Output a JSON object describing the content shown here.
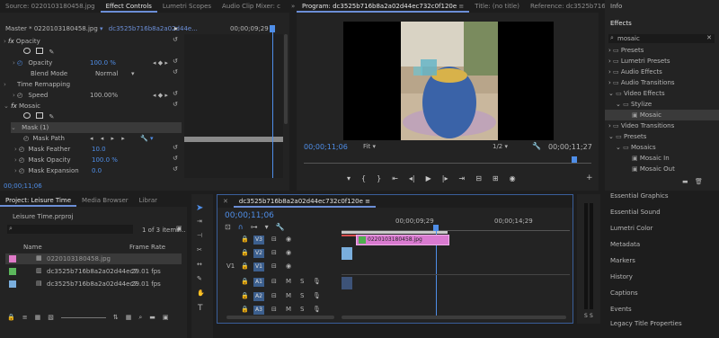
{
  "effect_controls": {
    "tabs": [
      "Source: 0220103180458.jpg",
      "Effect Controls",
      "Lumetri Scopes",
      "Audio Clip Mixer: c"
    ],
    "master": "Master * 0220103180458.jpg",
    "clip": "dc3525b716b8a2a02d44e...",
    "timecode_ruler": "00;00;09;29",
    "sections": {
      "opacity": "Opacity",
      "opacity_label": "Opacity",
      "opacity_value": "100.0 %",
      "blend_label": "Blend Mode",
      "blend_value": "Normal",
      "time_remap": "Time Remapping",
      "speed_label": "Speed",
      "speed_value": "100.00%",
      "mosaic": "Mosaic",
      "mask": "Mask (1)",
      "mask_path": "Mask Path",
      "mask_feather": "Mask Feather",
      "mask_feather_value": "10.0",
      "mask_opacity": "Mask Opacity",
      "mask_opacity_value": "100.0 %",
      "mask_expansion": "Mask Expansion",
      "mask_expansion_value": "0.0"
    },
    "timecode": "00;00;11;06"
  },
  "program": {
    "tabs": [
      "Program: dc3525b716b8a2a02d44ec732c0f120e",
      "Title: (no title)",
      "Reference: dc3525b716b8a2a02d44ec"
    ],
    "timecode": "00;00;11;06",
    "fit": "Fit",
    "resolution": "1/2",
    "duration": "00;00;11;27"
  },
  "project": {
    "tabs": [
      "Project: Leisure Time",
      "Media Browser",
      "Librar"
    ],
    "file": "Leisure Time.prproj",
    "items_count": "1 of 3 items...",
    "col_name": "Name",
    "col_rate": "Frame Rate",
    "items": [
      {
        "name": "0220103180458.jpg",
        "rate": "",
        "color": "#e07ac8"
      },
      {
        "name": "dc3525b716b8a2a02d44ec7",
        "rate": "29.01 fps",
        "color": "#5cb85c"
      },
      {
        "name": "dc3525b716b8a2a02d44ec7",
        "rate": "29.01 fps",
        "color": "#7aaedc"
      }
    ]
  },
  "timeline": {
    "tab": "dc3525b716b8a2a02d44ec732c0f120e",
    "timecode": "00;00;11;06",
    "ruler": [
      "00;00;09;29",
      "00;00;14;29"
    ],
    "clip_label": "0220103180458.jpg",
    "tracks_video": [
      "V3",
      "V2",
      "V1"
    ],
    "tracks_audio": [
      "A1",
      "A2",
      "A3"
    ],
    "src_patch": "V1",
    "m": "M",
    "s": "S"
  },
  "effects": {
    "title": "Effects",
    "info": "Info",
    "search": "mosaic",
    "tree": [
      {
        "label": "Presets",
        "level": 0
      },
      {
        "label": "Lumetri Presets",
        "level": 0
      },
      {
        "label": "Audio Effects",
        "level": 0
      },
      {
        "label": "Audio Transitions",
        "level": 0
      },
      {
        "label": "Video Effects",
        "level": 0
      },
      {
        "label": "Stylize",
        "level": 1
      },
      {
        "label": "Mosaic",
        "level": 2
      },
      {
        "label": "Video Transitions",
        "level": 0
      },
      {
        "label": "Presets",
        "level": 0
      },
      {
        "label": "Mosaics",
        "level": 1
      },
      {
        "label": "Mosaic In",
        "level": 2
      },
      {
        "label": "Mosaic Out",
        "level": 2
      }
    ],
    "panels": [
      "Essential Graphics",
      "Essential Sound",
      "Lumetri Color",
      "Metadata",
      "Markers",
      "History",
      "Captions",
      "Events",
      "Legacy Title Properties"
    ]
  },
  "audio_meter": {
    "s1": "S",
    "s2": "S"
  }
}
